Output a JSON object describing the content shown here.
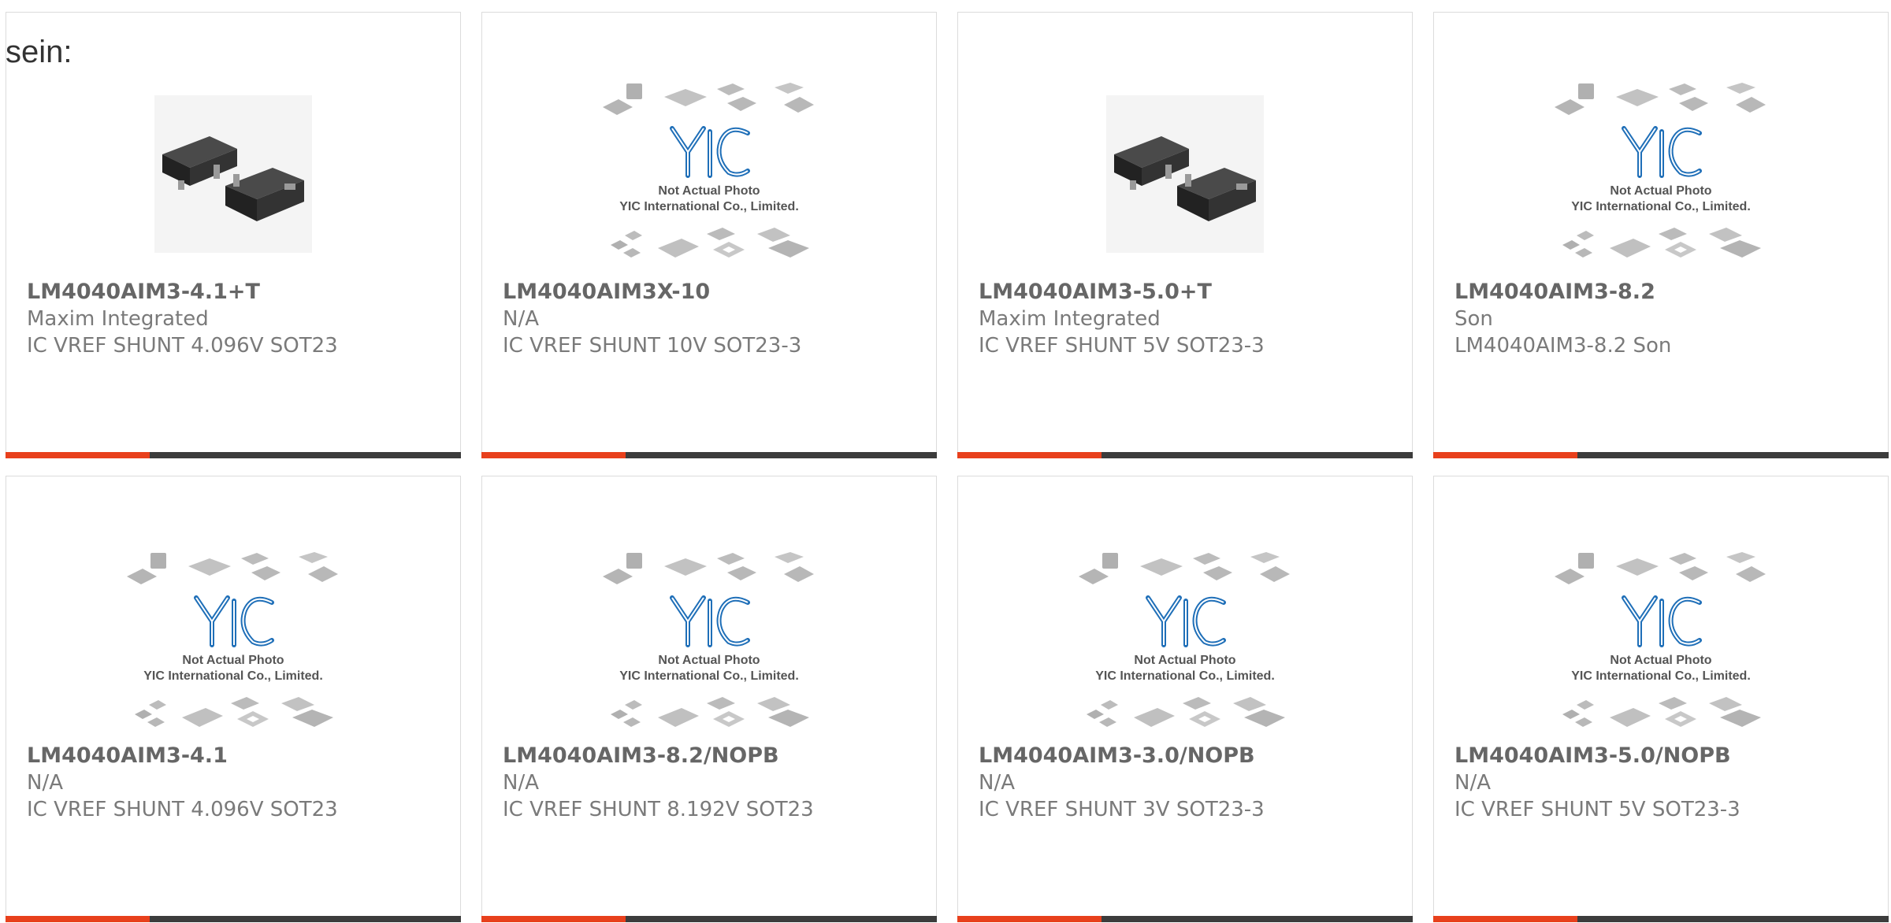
{
  "intro_text": "sein:",
  "placeholder_caption": {
    "line1": "Not Actual Photo",
    "line2": "YIC International Co., Limited.",
    "logo": "YIC"
  },
  "colors": {
    "accent": "#e8401c",
    "bar": "#3c3c3c",
    "logo_blue": "#1f6fb8"
  },
  "products": [
    {
      "part_number": "LM4040AIM3-4.1+T",
      "manufacturer": "Maxim Integrated",
      "description": "IC VREF SHUNT 4.096V SOT23",
      "image": "sot23-photo"
    },
    {
      "part_number": "LM4040AIM3X-10",
      "manufacturer": "N/A",
      "description": "IC VREF SHUNT 10V SOT23-3",
      "image": "yic-placeholder"
    },
    {
      "part_number": "LM4040AIM3-5.0+T",
      "manufacturer": "Maxim Integrated",
      "description": "IC VREF SHUNT 5V SOT23-3",
      "image": "sot23-photo"
    },
    {
      "part_number": "LM4040AIM3-8.2",
      "manufacturer": "Son",
      "description": "LM4040AIM3-8.2 Son",
      "image": "yic-placeholder"
    },
    {
      "part_number": "LM4040AIM3-4.1",
      "manufacturer": "N/A",
      "description": "IC VREF SHUNT 4.096V SOT23",
      "image": "yic-placeholder"
    },
    {
      "part_number": "LM4040AIM3-8.2/NOPB",
      "manufacturer": "N/A",
      "description": "IC VREF SHUNT 8.192V SOT23",
      "image": "yic-placeholder"
    },
    {
      "part_number": "LM4040AIM3-3.0/NOPB",
      "manufacturer": "N/A",
      "description": "IC VREF SHUNT 3V SOT23-3",
      "image": "yic-placeholder"
    },
    {
      "part_number": "LM4040AIM3-5.0/NOPB",
      "manufacturer": "N/A",
      "description": "IC VREF SHUNT 5V SOT23-3",
      "image": "yic-placeholder"
    }
  ]
}
